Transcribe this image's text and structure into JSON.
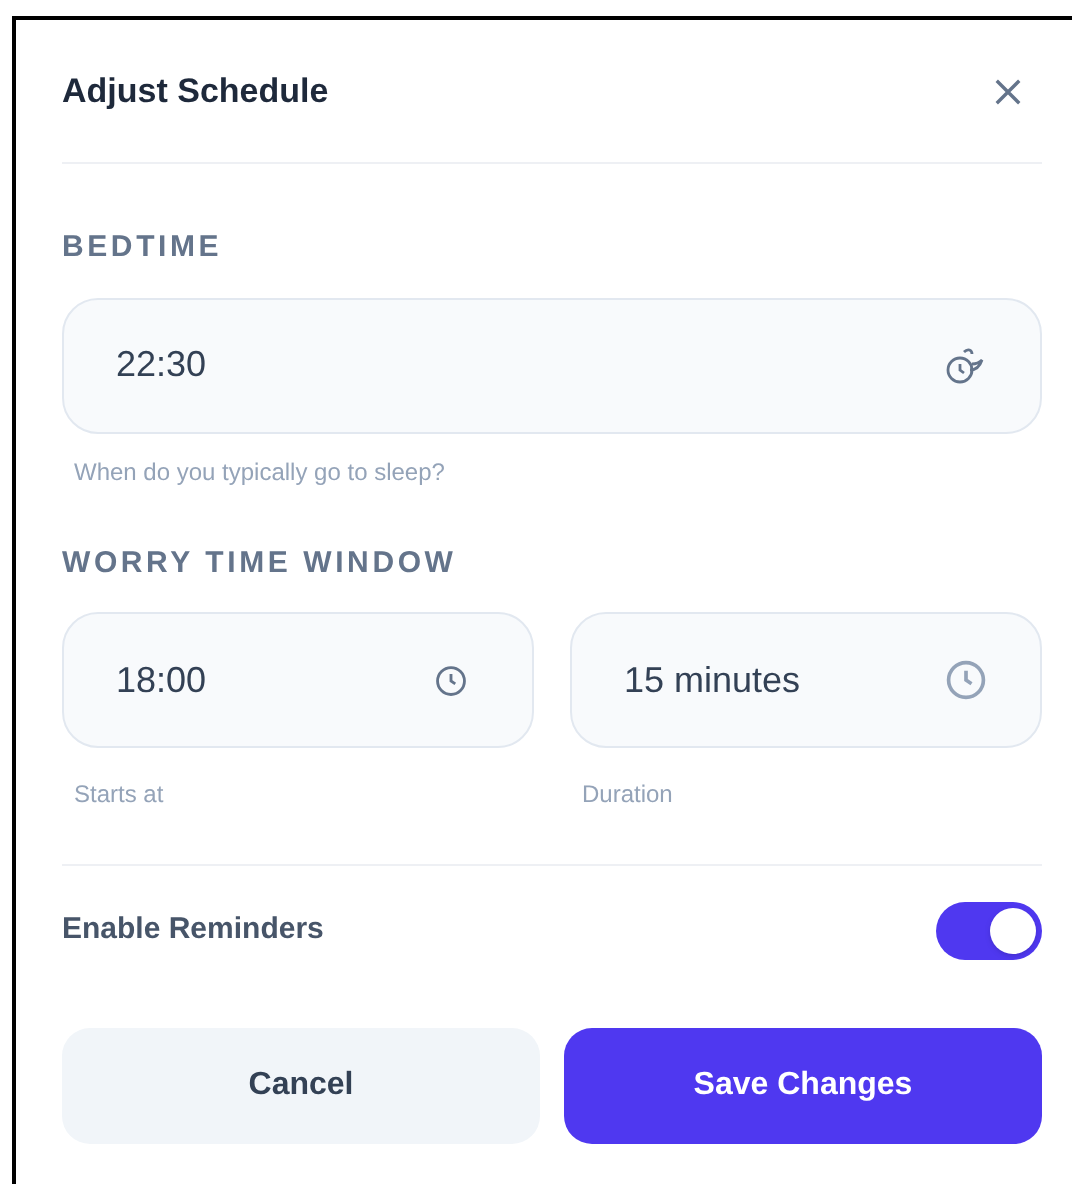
{
  "dialog": {
    "title": "Adjust Schedule"
  },
  "bedtime": {
    "label": "BEDTIME",
    "value": "22:30",
    "hint": "When do you typically go to sleep?"
  },
  "worry_window": {
    "label": "WORRY TIME WINDOW",
    "fields": [
      {
        "value": "18:00",
        "caption": "Starts at"
      },
      {
        "value": "15 minutes",
        "caption": "Duration"
      }
    ]
  },
  "reminders": {
    "label": "Enable Reminders",
    "on": true
  },
  "buttons": [
    {
      "label": "Cancel",
      "kind": "secondary"
    },
    {
      "label": "Save Changes",
      "kind": "primary"
    }
  ]
}
